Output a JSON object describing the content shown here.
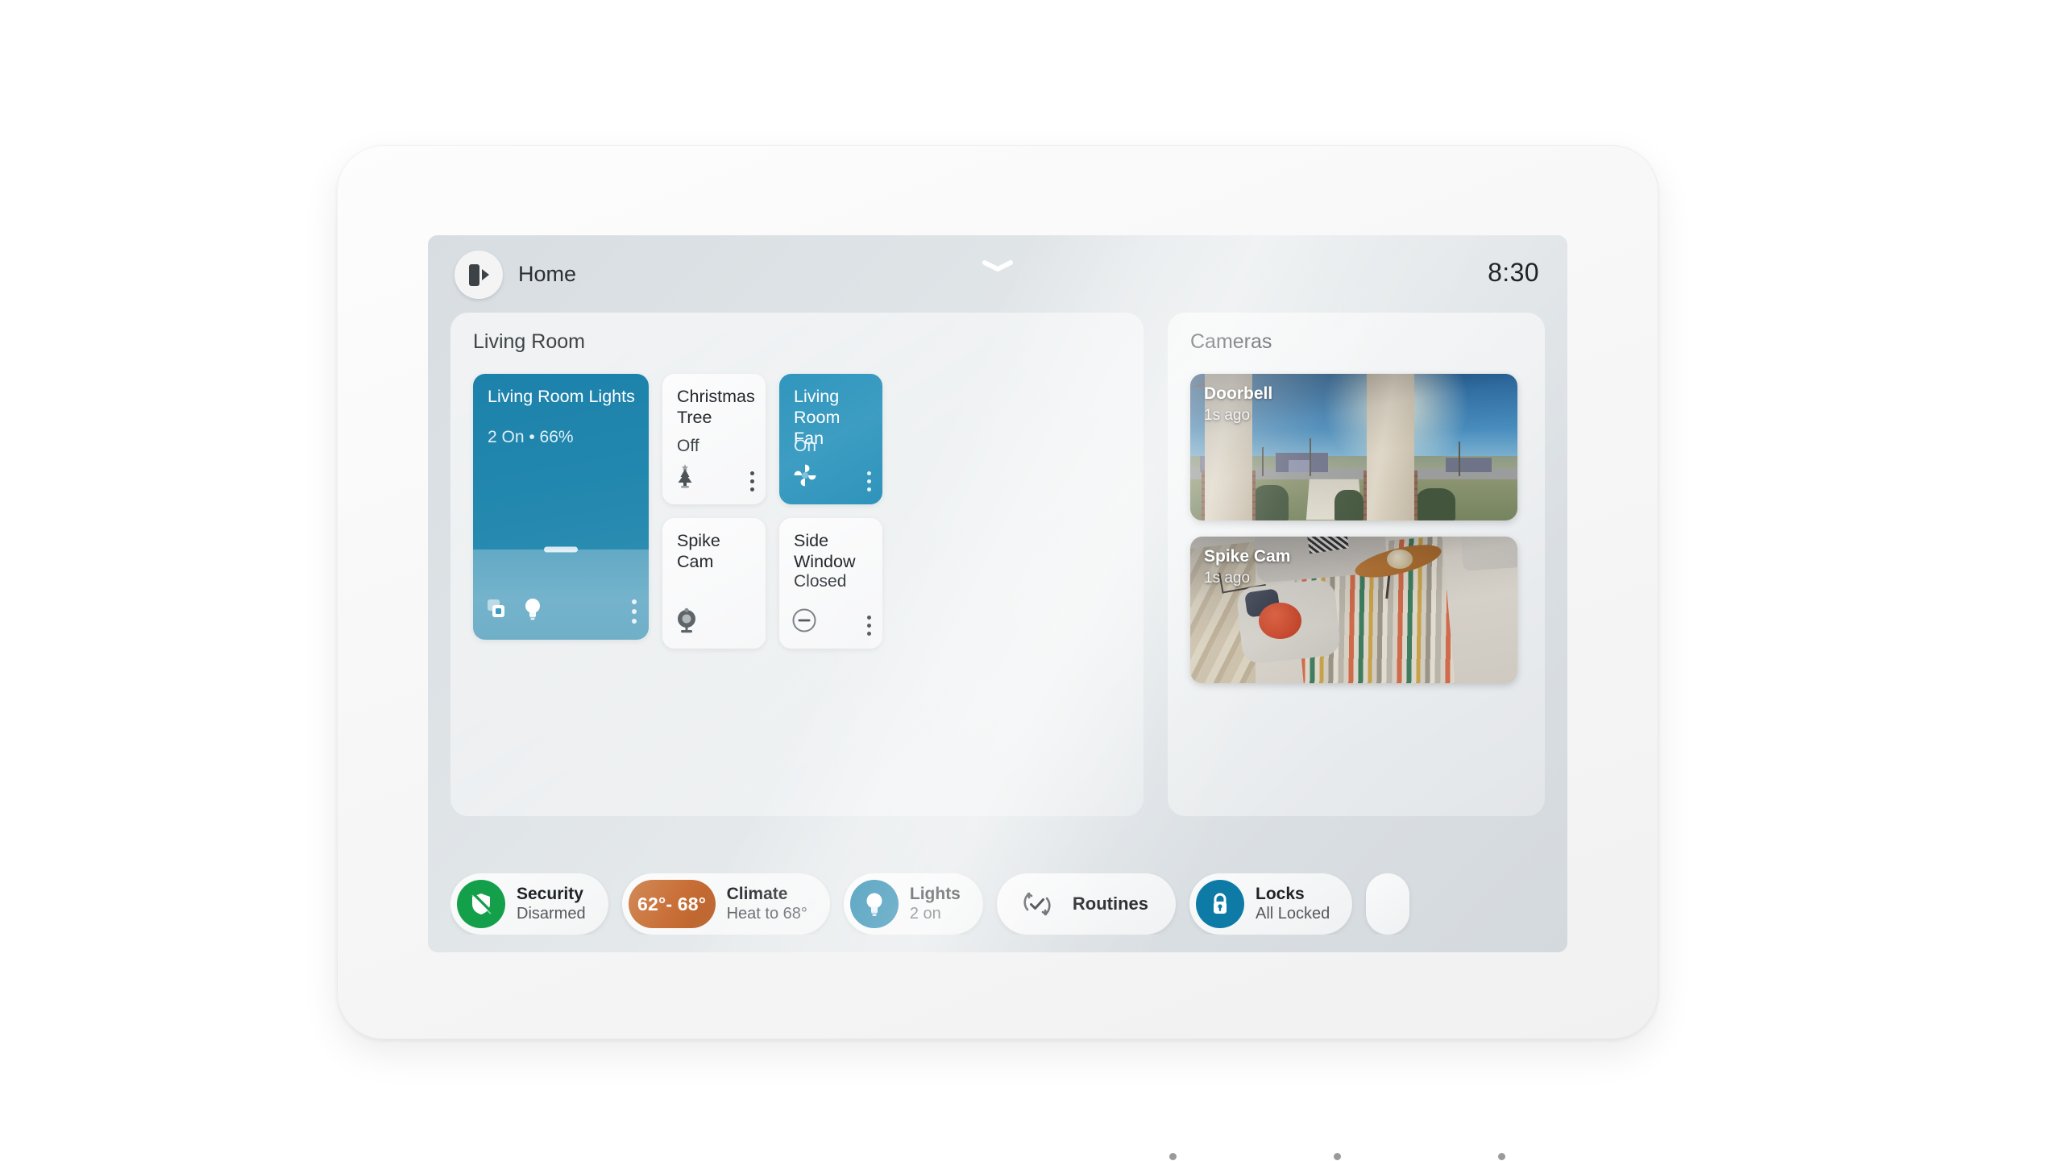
{
  "device": {
    "type": "smart-display"
  },
  "status_bar": {
    "home_label": "Home",
    "clock": "8:30",
    "avatar_icon": "home-door-icon",
    "pull_handle_icon": "chevron-down-icon"
  },
  "panels": {
    "living_room": {
      "title": "Living Room",
      "tiles": [
        {
          "name": "Living Room Lights",
          "status": "2 On • 66%",
          "state": "on",
          "brightness_percent": 66,
          "icons": [
            "group-stack-icon",
            "lightbulb-icon"
          ],
          "has_overflow_menu": true,
          "accent": "#1d82ab"
        },
        {
          "name": "Christmas Tree",
          "status": "Off",
          "state": "off",
          "icon": "christmas-tree-icon",
          "has_overflow_menu": true
        },
        {
          "name": "Living Room Fan",
          "status": "On",
          "state": "on",
          "icon": "fan-icon",
          "has_overflow_menu": true,
          "accent": "#3196bd"
        },
        {
          "name": "Spike Cam",
          "status": "",
          "state": "off",
          "icon": "webcam-icon",
          "has_overflow_menu": false
        },
        {
          "name": "Side Window",
          "status": "Closed",
          "state": "off",
          "icon": "contact-sensor-closed-icon",
          "has_overflow_menu": true
        }
      ]
    },
    "cameras": {
      "title": "Cameras",
      "feeds": [
        {
          "name": "Doorbell",
          "timestamp": "1s ago",
          "scene": "outdoor-driveway"
        },
        {
          "name": "Spike Cam",
          "timestamp": "1s ago",
          "scene": "indoor-living-room"
        }
      ]
    }
  },
  "quick_controls": [
    {
      "label": "Security",
      "value": "Disarmed",
      "icon": "shield-slash-icon",
      "icon_color": "#14a04a"
    },
    {
      "label": "Climate",
      "value": "Heat to 68°",
      "icon": "temperature-range-pill",
      "badge": "62°- 68°",
      "icon_color": "#c97038"
    },
    {
      "label": "Lights",
      "value": "2 on",
      "icon": "lightbulb-icon",
      "icon_color": "#0e7ba6"
    },
    {
      "label": "Routines",
      "value": "",
      "icon": "routines-check-icon",
      "icon_color": "#55595d"
    },
    {
      "label": "Locks",
      "value": "All Locked",
      "icon": "lock-closed-icon",
      "icon_color": "#0e7ba6"
    },
    {
      "label": "",
      "value": "",
      "icon": "partial-chip",
      "icon_color": "#dddddd"
    }
  ]
}
